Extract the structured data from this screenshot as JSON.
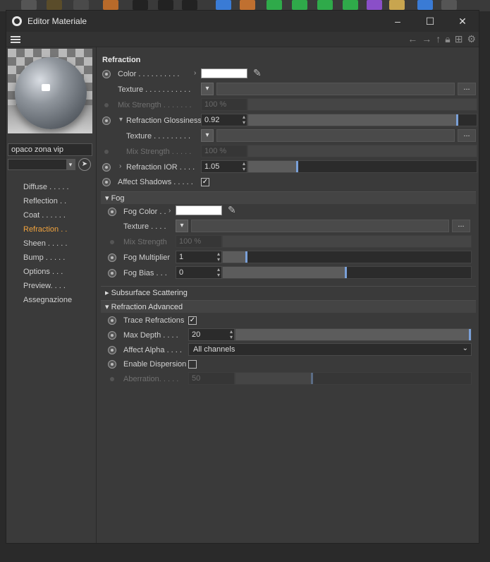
{
  "window": {
    "title": "Editor Materiale",
    "controls": [
      "–",
      "☐",
      "✕"
    ]
  },
  "toolbar": {
    "nav_icons": [
      "arrow-left-icon",
      "arrow-right-icon",
      "arrow-up-icon",
      "lock-icon",
      "new-window-icon",
      "settings-icon"
    ]
  },
  "material": {
    "name": "opaco zona vip"
  },
  "channels": [
    {
      "label": "Diffuse . . . . .",
      "active": false
    },
    {
      "label": "Reflection . .",
      "active": false
    },
    {
      "label": "Coat . . . . . .",
      "active": false
    },
    {
      "label": "Refraction . .",
      "active": true
    },
    {
      "label": "Sheen . . . . .",
      "active": false
    },
    {
      "label": "Bump . . . . .",
      "active": false
    },
    {
      "label": "Options . . .",
      "active": false
    },
    {
      "label": "Preview. . . .",
      "active": false
    },
    {
      "label": "Assegnazione",
      "active": false
    }
  ],
  "refraction": {
    "title": "Refraction",
    "color_label": "Color . . . . . . . . . .",
    "texture_label": "Texture . . . . . . . . . . .",
    "mix_label": "Mix Strength . . . . . . .",
    "mix_value": "100 %",
    "gloss_label": "Refraction Glossiness",
    "gloss_value": "0.92",
    "gloss_texture_label": "Texture . . . . . . . . .",
    "gloss_mix_label": "Mix Strength . . . . .",
    "gloss_mix_value": "100 %",
    "ior_label": "Refraction IOR . . . .",
    "ior_value": "1.05",
    "shadows_label": "Affect Shadows . . . . .",
    "dots": "..."
  },
  "fog": {
    "title": "Fog",
    "color_label": "Fog Color . .",
    "texture_label": "Texture . . . .",
    "mix_label": "Mix Strength",
    "mix_value": "100 %",
    "mult_label": "Fog Multiplier",
    "mult_value": "1",
    "bias_label": "Fog Bias . . .",
    "bias_value": "0",
    "dots": "..."
  },
  "sss": {
    "title": "Subsurface Scattering"
  },
  "advanced": {
    "title": "Refraction Advanced",
    "trace_label": "Trace Refractions",
    "depth_label": "Max Depth . . . .",
    "depth_value": "20",
    "alpha_label": "Affect Alpha . . . .",
    "alpha_value": "All channels",
    "disp_label": "Enable Dispersion",
    "aber_label": "Aberration. . . . .",
    "aber_value": "50"
  },
  "sliders": {
    "gloss": 0.92,
    "ior": 0.22,
    "fog_mult": 0.1,
    "fog_bias": 0.5,
    "depth": 1.0,
    "aber": 0.33
  },
  "colors": {
    "accent": "#f0a33e",
    "knob": "#7aa0d8"
  }
}
